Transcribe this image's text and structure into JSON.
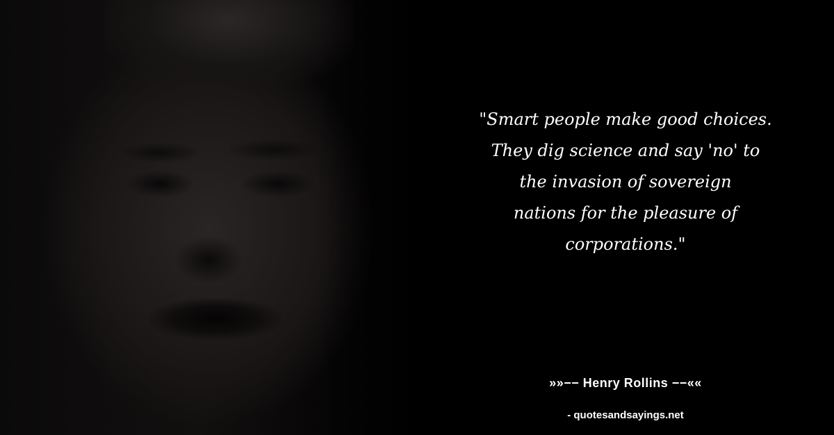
{
  "quote": {
    "text": "\"Smart people make good choices.\nThey dig science and say 'no' to\nthe invasion of sovereign\nnations for the pleasure of\ncorporations.\""
  },
  "author": {
    "line": "»»−− Henry Rollins −−««"
  },
  "source": {
    "site": "- quotesandsayings.net"
  },
  "colors": {
    "background": "#000000",
    "text": "#ffffff"
  }
}
